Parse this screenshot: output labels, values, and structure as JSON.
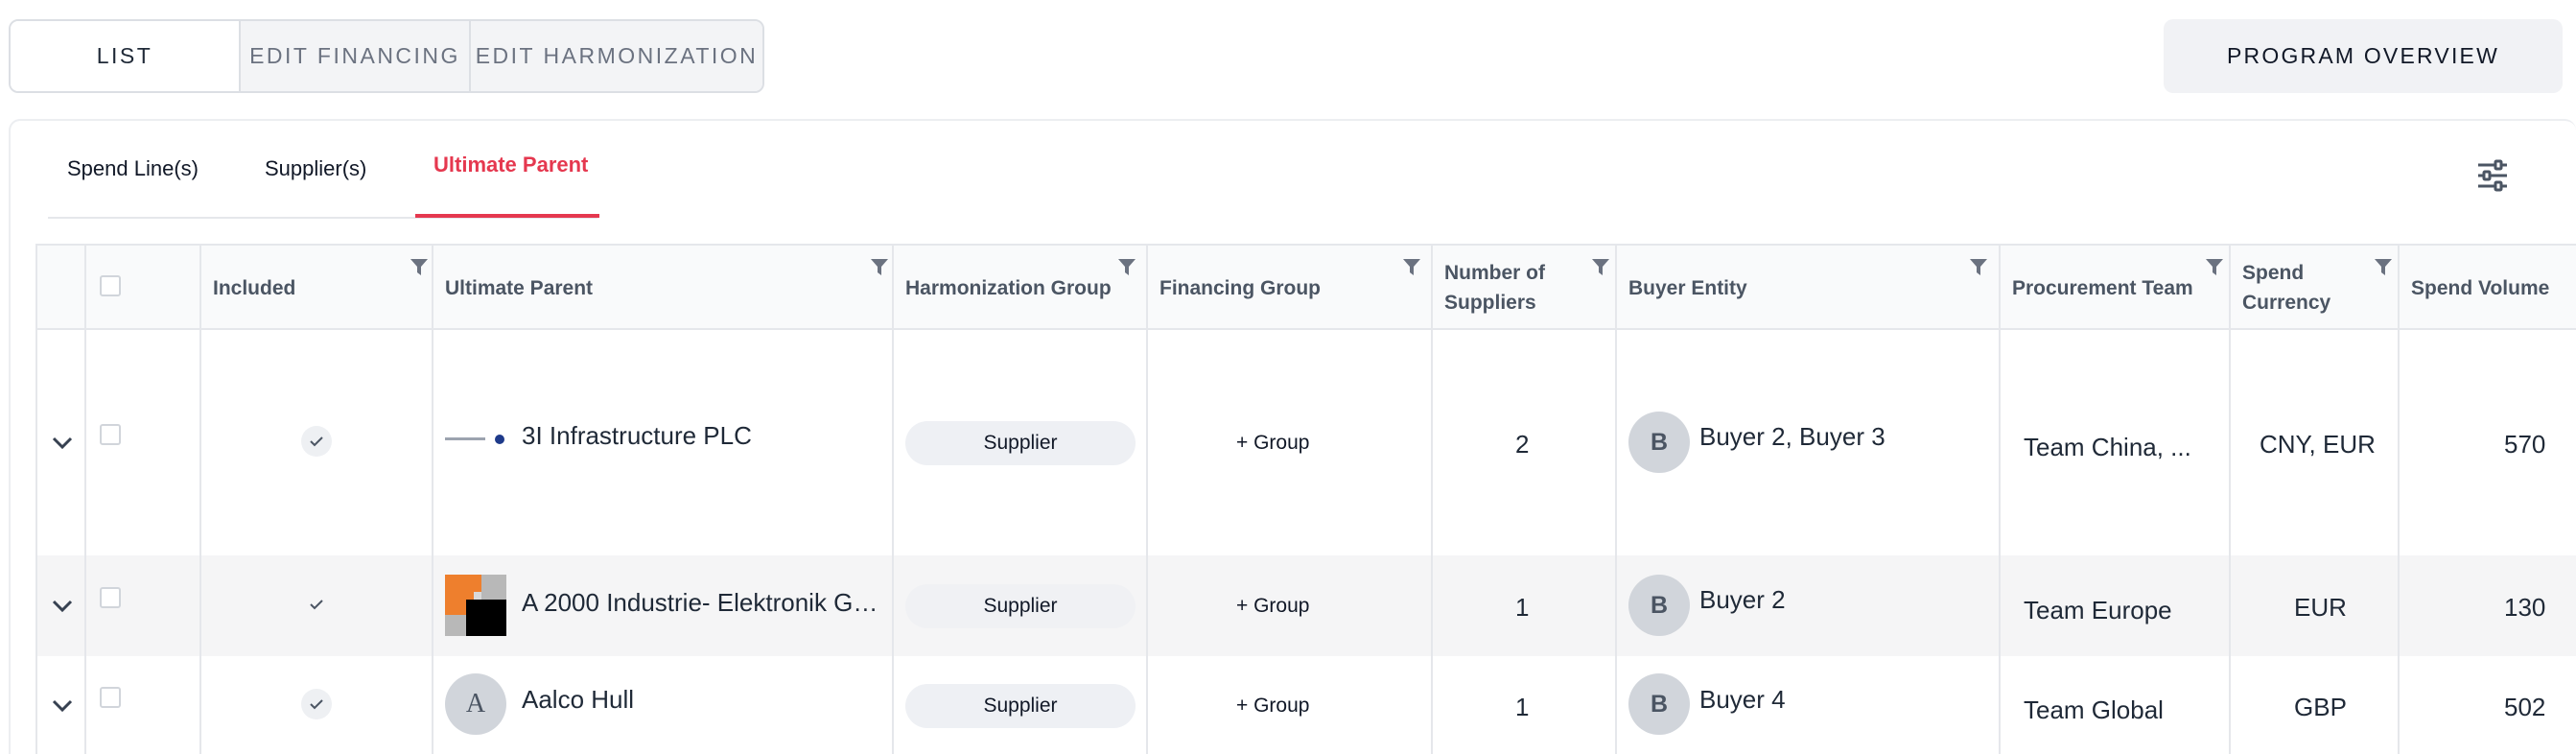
{
  "top_tabs": {
    "list": "LIST",
    "edit_financing": "EDIT FINANCING",
    "edit_harmonization": "EDIT HARMONIZATION"
  },
  "program_overview_label": "PROGRAM OVERVIEW",
  "sub_tabs": {
    "spend_lines": "Spend Line(s)",
    "suppliers": "Supplier(s)",
    "ultimate_parent": "Ultimate Parent"
  },
  "columns": {
    "included": "Included",
    "ultimate_parent": "Ultimate Parent",
    "harmonization_group": "Harmonization Group",
    "financing_group": "Financing Group",
    "number_of_suppliers": "Number of Suppliers",
    "buyer_entity": "Buyer Entity",
    "procurement_team": "Procurement Team",
    "spend_currency": "Spend Currency",
    "spend_volume": "Spend Volume"
  },
  "rows": [
    {
      "name": "3I Infrastructure PLC",
      "logo": "3i-infrastructure-logo",
      "harmonization_group": "Supplier",
      "financing_group": "+ Group",
      "number_of_suppliers": "2",
      "buyer_initial": "B",
      "buyer_entity": "Buyer 2, Buyer 3",
      "procurement_team": "Team China, ...",
      "spend_currency": "CNY, EUR",
      "spend_volume": "570"
    },
    {
      "name": "A 2000 Industrie- Elektronik Gm...",
      "logo": "a2000-logo",
      "harmonization_group": "Supplier",
      "financing_group": "+ Group",
      "number_of_suppliers": "1",
      "buyer_initial": "B",
      "buyer_entity": "Buyer 2",
      "procurement_team": "Team Europe",
      "spend_currency": "EUR",
      "spend_volume": "130"
    },
    {
      "name": "Aalco Hull",
      "logo_initial": "A",
      "harmonization_group": "Supplier",
      "financing_group": "+ Group",
      "number_of_suppliers": "1",
      "buyer_initial": "B",
      "buyer_entity": "Buyer 4",
      "procurement_team": "Team Global",
      "spend_currency": "GBP",
      "spend_volume": "502"
    }
  ],
  "colors": {
    "accent": "#e5384f",
    "header_bg": "#f9fafb",
    "pill_bg": "#eef0f4",
    "avatar_bg": "#d1d5db"
  }
}
